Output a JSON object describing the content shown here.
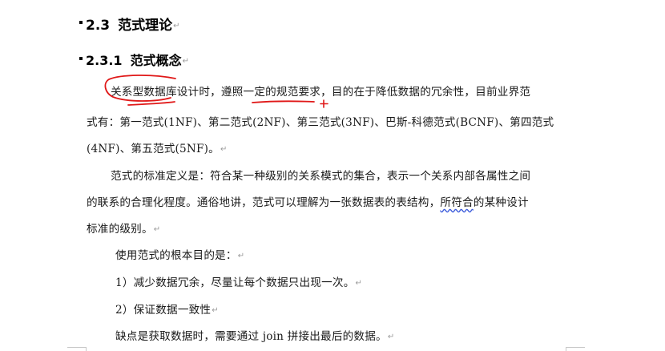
{
  "doc": {
    "heading_main": {
      "number": "2.3",
      "title": "范式理论"
    },
    "heading_sub": {
      "number": "2.3.1",
      "title": "范式概念"
    },
    "para1": {
      "line1": "关系型数据库设计时，遵照一定的规范要求，目的在于降低数据的冗余性，目前业界范",
      "line2": "式有：第一范式(1NF)、第二范式(2NF)、第三范式(3NF)、巴斯-科德范式(BCNF)、第四范式",
      "line3": "(4NF)、第五范式(5NF)。"
    },
    "para2": {
      "line1": "范式的标准定义是：符合某一种级别的关系模式的集合，表示一个关系内部各属性之间",
      "line2_pre": "的联系的合理化程度。通俗地讲，范式可以理解为一张数据表的表结构，",
      "line2_ul": "所符合",
      "line2_post": "的某种设计",
      "line3": "标准的级别。"
    },
    "para3": "使用范式的根本目的是：",
    "list": [
      "1）减少数据冗余，尽量让每个数据只出现一次。",
      "2）保证数据一致性"
    ],
    "para4": "缺点是获取数据时，需要通过 join 拼接出最后的数据。",
    "paragraph_mark": "↵",
    "annotation_color": "#e01818"
  }
}
